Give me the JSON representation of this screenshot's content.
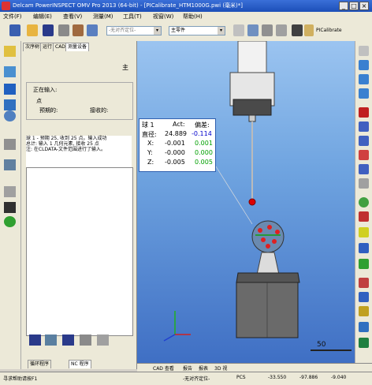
{
  "window": {
    "title": "Delcam PowerINSPECT OMV Pro 2013 (64-bit) - [PICalibrate_HTM1000G.pwi (毫米)*]"
  },
  "menu": [
    "文件(F)",
    "编辑(E)",
    "查看(V)",
    "测量(M)",
    "工具(T)",
    "视窗(W)",
    "帮助(H)"
  ],
  "toolbar": {
    "combo_left": "-无对齐定位-",
    "combo_main": "主零件",
    "calibrate_label": "PICalibrate"
  },
  "panel": {
    "tabs": [
      "次序树",
      "运行",
      "CAD",
      "测量设备"
    ],
    "section_label": "主",
    "input_group_label": "正在输入:",
    "point_label": "点",
    "expected_label": "预期的:",
    "received_label": "接收的:",
    "log_text": "球 1 - 预期 25, 收到 25 点。输入成功\n总计: 输入 1 几何元素, 接收 25 点\n注: 在CLDATA-文件范围进行了输入。",
    "bottom_tabs": [
      "循环程序",
      "NC 程序"
    ]
  },
  "result_box": {
    "header": [
      "球 1",
      "Act:",
      "偏差:"
    ],
    "rows": [
      {
        "label": "直径:",
        "act": "24.889",
        "dev": "-0.114"
      },
      {
        "label": "X:",
        "act": "-0.001",
        "dev": "0.001"
      },
      {
        "label": "Y:",
        "act": "-0.000",
        "dev": "0.000"
      },
      {
        "label": "Z:",
        "act": "-0.005",
        "dev": "0.005"
      }
    ]
  },
  "scale_label": "50",
  "view_tabs": [
    "CAD 查看",
    "报告",
    "报表",
    "3D 视"
  ],
  "status": {
    "help": "寻求帮助请按F1",
    "align": "-无对齐定位-",
    "coord_system": "PCS",
    "x": "-33.550",
    "y": "-97.886",
    "z": "-9.040"
  },
  "colors": {
    "accent_blue": "#1c4fb8",
    "dev_blue": "#0000cc",
    "dev_green": "#00a000",
    "viewport_bg": "#6fa4e0"
  }
}
